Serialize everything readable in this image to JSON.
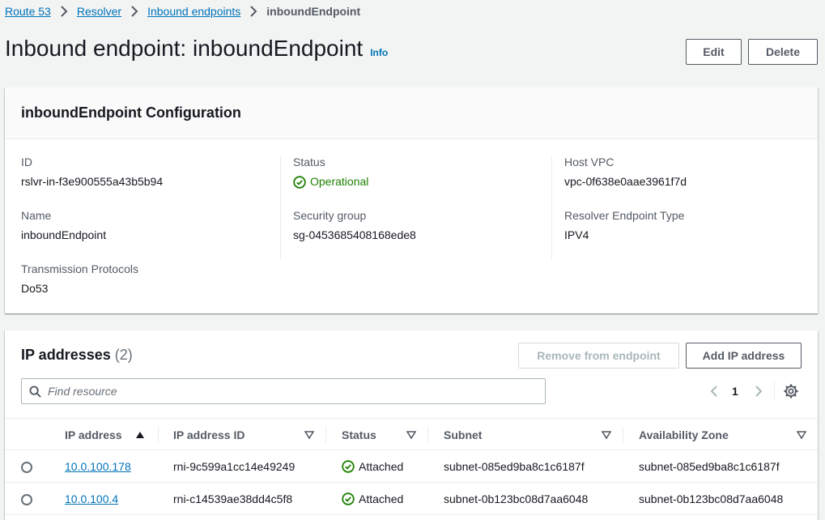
{
  "breadcrumb": {
    "items": [
      "Route 53",
      "Resolver",
      "Inbound endpoints"
    ],
    "current": "inboundEndpoint"
  },
  "header": {
    "title": "Inbound endpoint: inboundEndpoint",
    "info_label": "Info",
    "edit_label": "Edit",
    "delete_label": "Delete"
  },
  "config": {
    "title": "inboundEndpoint Configuration",
    "id_label": "ID",
    "id_value": "rslvr-in-f3e900555a43b5b94",
    "status_label": "Status",
    "status_value": "Operational",
    "host_vpc_label": "Host VPC",
    "host_vpc_value": "vpc-0f638e0aae3961f7d",
    "name_label": "Name",
    "name_value": "inboundEndpoint",
    "security_group_label": "Security group",
    "security_group_value": "sg-0453685408168ede8",
    "endpoint_type_label": "Resolver Endpoint Type",
    "endpoint_type_value": "IPV4",
    "protocols_label": "Transmission Protocols",
    "protocols_value": "Do53"
  },
  "ip_addresses": {
    "title": "IP addresses",
    "count": "(2)",
    "remove_label": "Remove from endpoint",
    "add_label": "Add IP address",
    "search_placeholder": "Find resource",
    "page": "1",
    "columns": [
      "IP address",
      "IP address ID",
      "Status",
      "Subnet",
      "Availability Zone"
    ],
    "rows": [
      {
        "ip": "10.0.100.178",
        "ip_id": "rni-9c599a1cc14e49249",
        "status": "Attached",
        "subnet": "subnet-085ed9ba8c1c6187f",
        "az": "subnet-085ed9ba8c1c6187f"
      },
      {
        "ip": "10.0.100.4",
        "ip_id": "rni-c14539ae38dd4c5f8",
        "status": "Attached",
        "subnet": "subnet-0b123bc08d7aa6048",
        "az": "subnet-0b123bc08d7aa6048"
      }
    ]
  },
  "colors": {
    "link": "#0073bb",
    "success": "#1d8102",
    "text": "#16191f",
    "muted": "#545b64",
    "background": "#f2f3f3"
  }
}
